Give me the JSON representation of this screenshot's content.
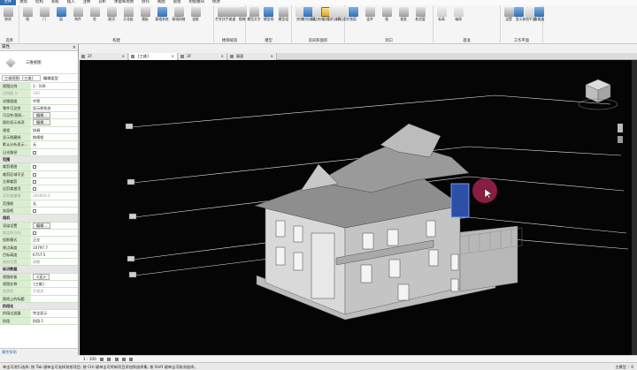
{
  "menu": [
    "文件",
    "建筑",
    "结构",
    "系统",
    "插入",
    "注释",
    "分析",
    "体量和场地",
    "协作",
    "视图",
    "管理",
    "附加模块",
    "修改"
  ],
  "menu_active_index": 0,
  "ribbon": {
    "groups": [
      {
        "label": "选择",
        "buttons": [
          {
            "label": "修改",
            "icon": "arrow-cursor-icon",
            "color": "gray"
          }
        ]
      },
      {
        "label": "构建",
        "buttons": [
          {
            "label": "墙",
            "icon": "wall-icon",
            "color": "gray"
          },
          {
            "label": "门",
            "icon": "door-icon",
            "color": "gray"
          },
          {
            "label": "窗",
            "icon": "window-icon",
            "color": "blue"
          },
          {
            "label": "构件",
            "icon": "component-icon",
            "color": "gray"
          },
          {
            "label": "柱",
            "icon": "column-icon",
            "color": "gray"
          },
          {
            "label": "屋顶",
            "icon": "roof-icon",
            "color": "gray"
          },
          {
            "label": "天花板",
            "icon": "ceiling-icon",
            "color": "gray"
          },
          {
            "label": "楼板",
            "icon": "floor-icon",
            "color": "gray"
          },
          {
            "label": "幕墙系统",
            "icon": "curtain-system-icon",
            "color": "blue"
          },
          {
            "label": "幕墙网格",
            "icon": "curtain-grid-icon",
            "color": "gray"
          },
          {
            "label": "竖梃",
            "icon": "mullion-icon",
            "color": "gray"
          }
        ]
      },
      {
        "label": "楼梯坡道",
        "buttons": [
          {
            "label": "栏杆扶手",
            "icon": "railing-icon",
            "color": "gray"
          },
          {
            "label": "坡道",
            "icon": "ramp-icon",
            "color": "gray"
          },
          {
            "label": "楼梯",
            "icon": "stair-icon",
            "color": "gray"
          }
        ]
      },
      {
        "label": "模型",
        "buttons": [
          {
            "label": "模型文字",
            "icon": "model-text-icon",
            "color": "gray"
          },
          {
            "label": "模型线",
            "icon": "model-line-icon",
            "color": "blue"
          },
          {
            "label": "模型组",
            "icon": "model-group-icon",
            "color": "gray"
          }
        ]
      },
      {
        "label": "房间和面积",
        "buttons": [
          {
            "label": "房间",
            "icon": "room-icon",
            "color": "faded"
          },
          {
            "label": "房间分隔",
            "icon": "room-separator-icon",
            "color": "blue"
          },
          {
            "label": "标记房间",
            "icon": "tag-room-icon",
            "color": "faded"
          },
          {
            "label": "面积",
            "icon": "area-icon",
            "color": "gold"
          },
          {
            "label": "面积边界",
            "icon": "area-boundary-icon",
            "color": "faded"
          },
          {
            "label": "标记面积",
            "icon": "tag-area-icon",
            "color": "faded"
          }
        ]
      },
      {
        "label": "洞口",
        "buttons": [
          {
            "label": "按面",
            "icon": "by-face-icon",
            "color": "blue"
          },
          {
            "label": "竖井",
            "icon": "shaft-icon",
            "color": "gray"
          },
          {
            "label": "墙",
            "icon": "wall-opening-icon",
            "color": "gray"
          },
          {
            "label": "垂直",
            "icon": "vertical-icon",
            "color": "gray"
          },
          {
            "label": "老虎窗",
            "icon": "dormer-icon",
            "color": "gray"
          }
        ]
      },
      {
        "label": "基准",
        "buttons": [
          {
            "label": "标高",
            "icon": "level-icon",
            "color": "faded"
          },
          {
            "label": "轴网",
            "icon": "grid-icon",
            "color": "faded"
          }
        ]
      },
      {
        "label": "工作平面",
        "buttons": [
          {
            "label": "设置",
            "icon": "set-icon",
            "color": "gray"
          },
          {
            "label": "显示",
            "icon": "show-icon",
            "color": "blue"
          },
          {
            "label": "参照平面",
            "icon": "ref-plane-icon",
            "color": "faded"
          },
          {
            "label": "查看器",
            "icon": "viewer-icon",
            "color": "blue"
          }
        ]
      }
    ]
  },
  "properties": {
    "title": "属性",
    "type_name": "三维视图",
    "selector": "三维视图: {三维}",
    "edit_type": "编辑类型",
    "rows": [
      {
        "k": "视图比例",
        "v": "1 : 100"
      },
      {
        "k": "比例值 1:",
        "v": "100",
        "dim": true
      },
      {
        "k": "详细程度",
        "v": "中等"
      },
      {
        "k": "零件可见性",
        "v": "显示原状态"
      },
      {
        "k": "可见性/图形...",
        "v": "编辑...",
        "btn": true
      },
      {
        "k": "图形显示选项",
        "v": "编辑...",
        "btn": true
      },
      {
        "k": "规程",
        "v": "协调"
      },
      {
        "k": "显示隐藏线",
        "v": "按规程"
      },
      {
        "k": "默认分析显示...",
        "v": "无"
      },
      {
        "k": "日光路径",
        "v": "",
        "chk": true
      },
      {
        "k": "范围",
        "v": "",
        "hdr": true
      },
      {
        "k": "裁剪视图",
        "v": "",
        "chk": true
      },
      {
        "k": "裁剪区域可见",
        "v": "",
        "chk": true
      },
      {
        "k": "注释裁剪",
        "v": "",
        "chk": true
      },
      {
        "k": "远剪裁激活",
        "v": "",
        "chk": true
      },
      {
        "k": "远剪裁偏移",
        "v": "304800.0",
        "dim": true
      },
      {
        "k": "范围框",
        "v": "无"
      },
      {
        "k": "剖面框",
        "v": "",
        "chk": true
      },
      {
        "k": "相机",
        "v": "",
        "hdr": true
      },
      {
        "k": "渲染设置",
        "v": "编辑...",
        "btn": true
      },
      {
        "k": "锁定的方向",
        "v": "",
        "chk": true,
        "dim": true
      },
      {
        "k": "投影模式",
        "v": "正交"
      },
      {
        "k": "视点高度",
        "v": "10797.7"
      },
      {
        "k": "目标高度",
        "v": "6757.5"
      },
      {
        "k": "相机位置",
        "v": "调整",
        "dim": true
      },
      {
        "k": "标识数据",
        "v": "",
        "hdr": true
      },
      {
        "k": "视图样板",
        "v": "<无>",
        "btn": true
      },
      {
        "k": "视图名称",
        "v": "{三维}"
      },
      {
        "k": "相关性",
        "v": "不相关",
        "dim": true
      },
      {
        "k": "图纸上的标题",
        "v": ""
      },
      {
        "k": "阶段化",
        "v": "",
        "hdr": true
      },
      {
        "k": "阶段过滤器",
        "v": "完全显示"
      },
      {
        "k": "阶段",
        "v": "阶段 1"
      }
    ],
    "help_link": "属性帮助"
  },
  "tabs": [
    {
      "label": "2F"
    },
    {
      "label": "{三维}",
      "active": true
    },
    {
      "label": "3F"
    },
    {
      "label": "屋面"
    }
  ],
  "viewport": {
    "background": "#050505",
    "highlight_color": "#c0285e"
  },
  "view_control_bar": {
    "scale": "1 : 100"
  },
  "status_bar": {
    "left": "单击可进行选择; 按 Tab 键单击可选择其他项目; 按 Ctrl 键单击可将新项目添加到选择集; 按 Shift 键单击可取消选择。",
    "model": "主模型",
    "filter": "：0"
  }
}
